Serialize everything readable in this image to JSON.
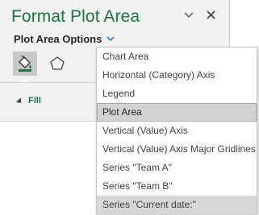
{
  "pane": {
    "title": "Format Plot Area",
    "options_label": "Plot Area Options",
    "section_label": "Fill",
    "icons": {
      "collapse": "chevron-down-icon",
      "close": "close-icon",
      "fill_tab": "paint-bucket-icon",
      "effects_tab": "pentagon-icon",
      "options_chevron": "chevron-down-icon"
    },
    "colors": {
      "title": "#217346",
      "selected_item_bg": "#d2d2d2"
    }
  },
  "dropdown": {
    "selected": "Plot Area",
    "items": [
      "Chart Area",
      "Horizontal (Category) Axis",
      "Legend",
      "Plot Area",
      "Vertical (Value) Axis",
      "Vertical (Value) Axis Major Gridlines",
      "Series \"Team A\"",
      "Series \"Team B\"",
      "Series \"Current date:\""
    ]
  }
}
